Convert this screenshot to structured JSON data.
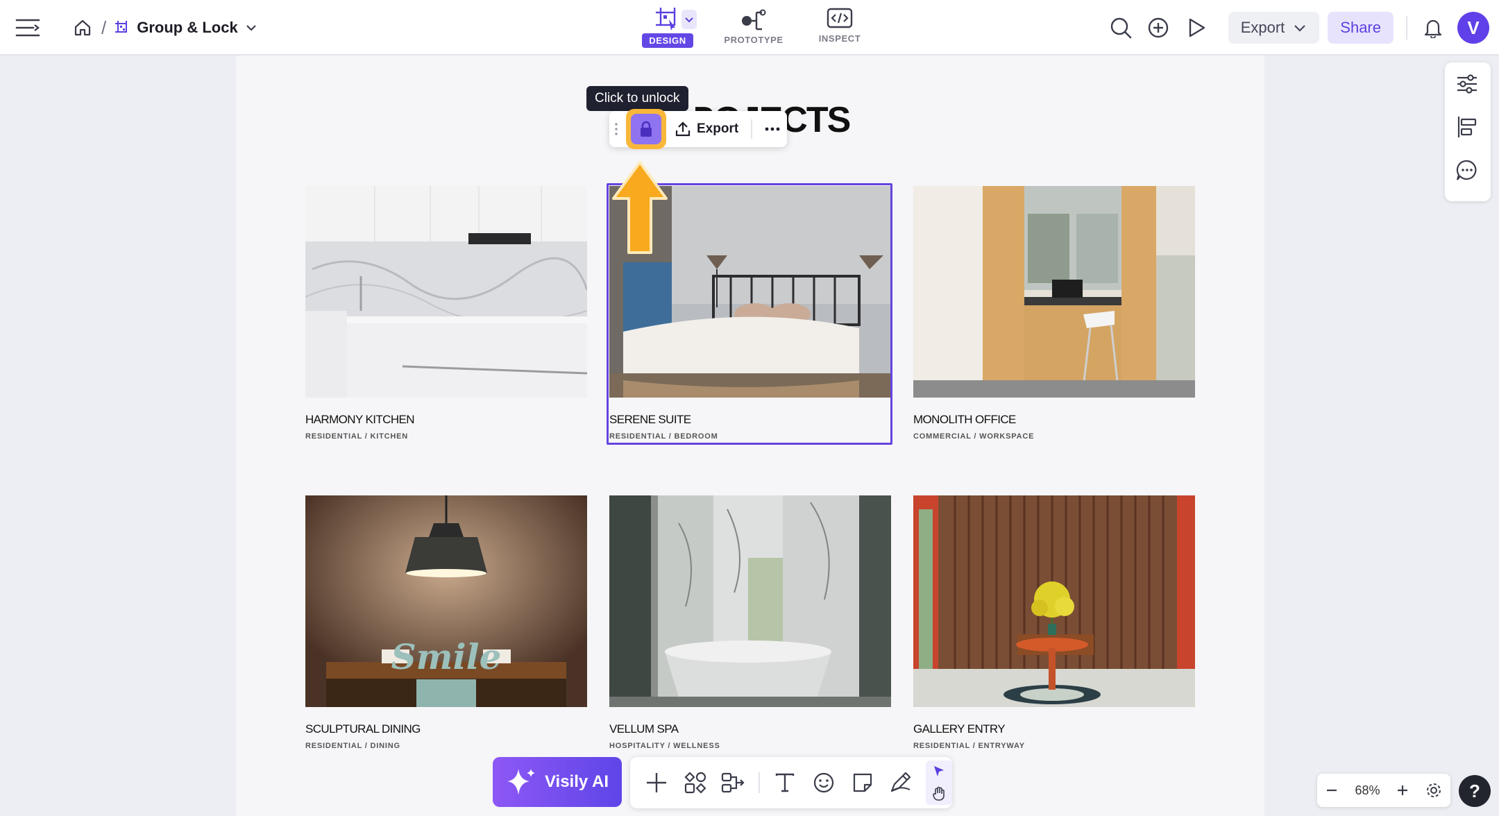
{
  "header": {
    "breadcrumb_file": "Group & Lock",
    "modes": [
      {
        "label": "DESIGN",
        "active": true
      },
      {
        "label": "PROTOTYPE",
        "active": false
      },
      {
        "label": "INSPECT",
        "active": false
      }
    ],
    "export_label": "Export",
    "share_label": "Share",
    "avatar_letter": "V"
  },
  "canvas": {
    "section_title": "PROJECTS",
    "cards": [
      {
        "name": "HARMONY KITCHEN",
        "category": "RESIDENTIAL / KITCHEN"
      },
      {
        "name": "SERENE SUITE",
        "category": "RESIDENTIAL / BEDROOM"
      },
      {
        "name": "MONOLITH OFFICE",
        "category": "COMMERCIAL / WORKSPACE"
      },
      {
        "name": "SCULPTURAL DINING",
        "category": "RESIDENTIAL / DINING"
      },
      {
        "name": "VELLUM SPA",
        "category": "HOSPITALITY / WELLNESS"
      },
      {
        "name": "GALLERY ENTRY",
        "category": "RESIDENTIAL / ENTRYWAY"
      }
    ],
    "dining_sign": "Smile"
  },
  "floating_toolbar": {
    "tooltip": "Click to unlock",
    "export_label": "Export"
  },
  "bottom": {
    "ai_label": "Visily AI",
    "zoom": "68%",
    "help": "?"
  },
  "colors": {
    "accent": "#6448e6",
    "highlight": "#f9b73a"
  }
}
